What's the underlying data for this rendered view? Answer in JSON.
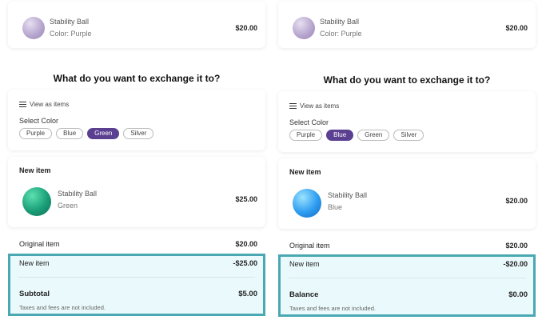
{
  "left": {
    "original": {
      "name": "Stability Ball",
      "variant": "Color: Purple",
      "price": "$20.00",
      "swatch_icon": "purple-ball"
    },
    "heading": "What do you want to exchange it to?",
    "options": {
      "view_as_label": "View as items",
      "select_label": "Select Color",
      "colors": [
        "Purple",
        "Blue",
        "Green",
        "Silver"
      ],
      "selected": "Green"
    },
    "new_item": {
      "title": "New item",
      "name": "Stability Ball",
      "variant": "Green",
      "price": "$25.00",
      "swatch_icon": "green-ball"
    },
    "summary": {
      "original_label": "Original item",
      "original_amount": "$20.00",
      "new_label": "New item",
      "new_amount": "-$25.00",
      "total_label": "Subtotal",
      "total_amount": "$5.00",
      "taxes_note": "Taxes and fees are not included."
    }
  },
  "right": {
    "original": {
      "name": "Stability Ball",
      "variant": "Color: Purple",
      "price": "$20.00",
      "swatch_icon": "purple-ball"
    },
    "heading": "What do you want to exchange it to?",
    "options": {
      "view_as_label": "View as items",
      "select_label": "Select Color",
      "colors": [
        "Purple",
        "Blue",
        "Green",
        "Silver"
      ],
      "selected": "Blue"
    },
    "new_item": {
      "title": "New item",
      "name": "Stability Ball",
      "variant": "Blue",
      "price": "$20.00",
      "swatch_icon": "blue-ball"
    },
    "summary": {
      "original_label": "Original item",
      "original_amount": "$20.00",
      "new_label": "New item",
      "new_amount": "-$20.00",
      "total_label": "Balance",
      "total_amount": "$0.00",
      "taxes_note": "Taxes and fees are not included."
    }
  },
  "colors": {
    "selected_chip": "#5b3f91",
    "highlight_border": "#4aa8b3",
    "highlight_fill": "#eaf9fb"
  }
}
